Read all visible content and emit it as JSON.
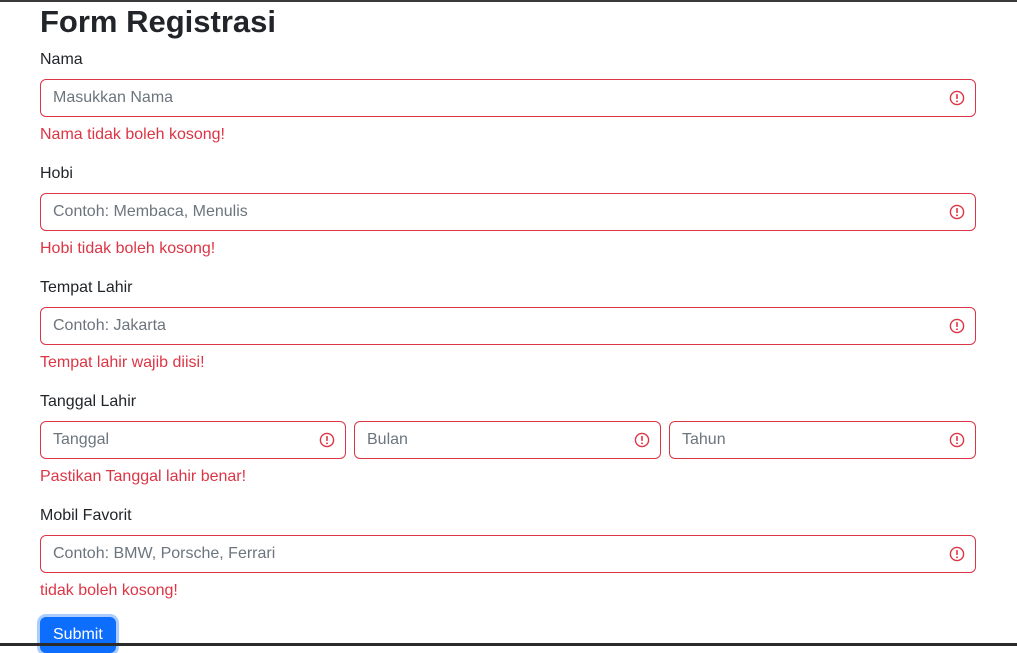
{
  "form": {
    "title": "Form Registrasi",
    "fields": {
      "nama": {
        "label": "Nama",
        "placeholder": "Masukkan Nama",
        "value": "",
        "error": "Nama tidak boleh kosong!"
      },
      "hobi": {
        "label": "Hobi",
        "placeholder": "Contoh: Membaca, Menulis",
        "value": "",
        "error": "Hobi tidak boleh kosong!"
      },
      "tempat_lahir": {
        "label": "Tempat Lahir",
        "placeholder": "Contoh: Jakarta",
        "value": "",
        "error": "Tempat lahir wajib diisi!"
      },
      "tanggal_lahir": {
        "label": "Tanggal Lahir",
        "tanggal_placeholder": "Tanggal",
        "bulan_placeholder": "Bulan",
        "tahun_placeholder": "Tahun",
        "error": "Pastikan Tanggal lahir benar!"
      },
      "mobil_favorit": {
        "label": "Mobil Favorit",
        "placeholder": "Contoh: BMW, Porsche, Ferrari",
        "value": "",
        "error": "tidak boleh kosong!"
      }
    },
    "submit_label": "Submit"
  },
  "icons": {
    "field_error": "exclamation-circle-icon"
  },
  "colors": {
    "error": "#dc3545",
    "primary": "#0d6efd",
    "text": "#212529",
    "placeholder": "#6c757d"
  }
}
